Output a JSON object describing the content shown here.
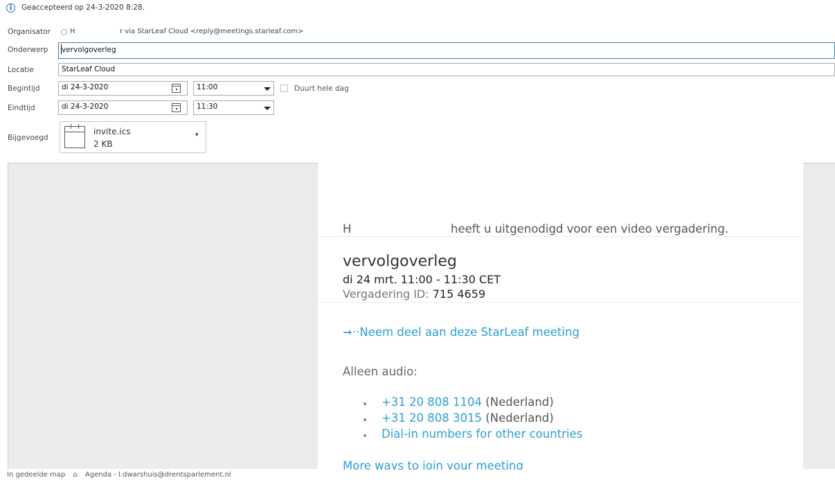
{
  "status": {
    "icon": "info-icon",
    "text": "Geaccepteerd op 24-3-2020 8:28."
  },
  "form": {
    "organizer": {
      "label": "Organisator",
      "name": "H",
      "via": "r via StarLeaf Cloud <reply@meetings.starleaf.com>"
    },
    "subject": {
      "label": "Onderwerp",
      "value": "vervolgoverleg"
    },
    "location": {
      "label": "Locatie",
      "value": "StarLeaf Cloud"
    },
    "start": {
      "label": "Begintijd",
      "date": "di 24-3-2020",
      "time": "11:00",
      "all_day_label": "Duurt hele dag"
    },
    "end": {
      "label": "Eindtijd",
      "date": "di 24-3-2020",
      "time": "11:30"
    },
    "attached": {
      "label": "Bijgevoegd",
      "file_name": "invite.ics",
      "file_size": "2 KB"
    }
  },
  "mail": {
    "inviter": "H",
    "invite_text": "heeft u uitgenodigd voor een video vergadering.",
    "meeting_title": "vervolgoverleg",
    "meeting_time": "di 24 mrt. 11:00 - 11:30 CET",
    "meeting_id_label": "Vergadering ID:",
    "meeting_id": "715 4659",
    "join_arrow": "➞··",
    "join_link": "Neem deel aan deze StarLeaf meeting",
    "audio_heading": "Alleen audio:",
    "phones": [
      {
        "number": "+31 20 808 1104",
        "country": "(Nederland)"
      },
      {
        "number": "+31 20 808 3015",
        "country": "(Nederland)"
      }
    ],
    "dial_in_link": "Dial-in numbers for other countries",
    "more_ways_link": "More ways to join your meeting"
  },
  "footer": {
    "folder_label": "In gedeelde map",
    "calendar": "Agenda - l.dwarshuis@drentsparlement.nl"
  },
  "colors": {
    "link": "#2a9fd6",
    "accent_border": "#3c7fb1",
    "preview_bg": "#ebebeb"
  }
}
